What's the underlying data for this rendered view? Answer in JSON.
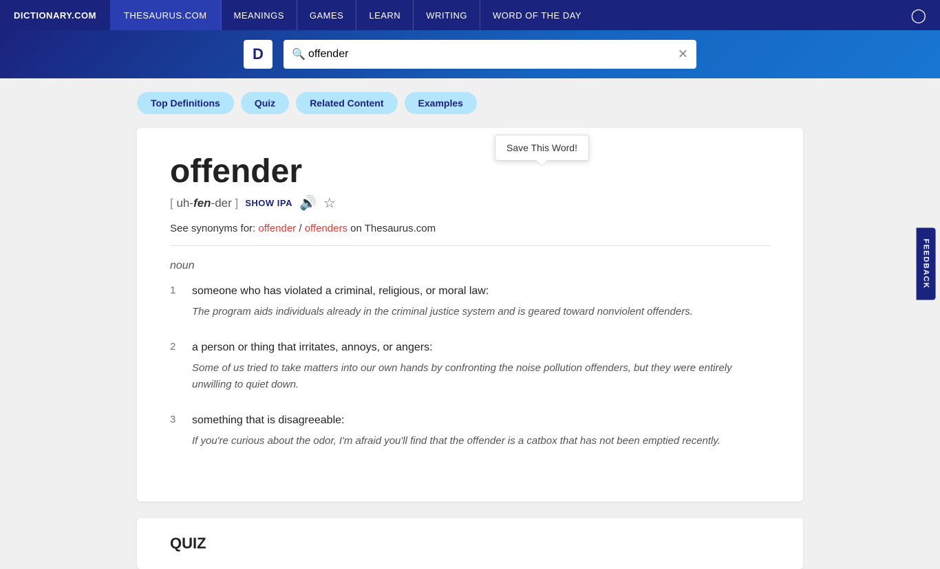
{
  "topnav": {
    "brand": "DICTIONARY.COM",
    "thesaurus": "THESAURUS.COM",
    "links": [
      "MEANINGS",
      "GAMES",
      "LEARN",
      "WRITING",
      "WORD OF THE DAY"
    ]
  },
  "search": {
    "value": "offender",
    "placeholder": "offender"
  },
  "logo": {
    "letter": "D"
  },
  "tabs": [
    {
      "label": "Top Definitions"
    },
    {
      "label": "Quiz"
    },
    {
      "label": "Related Content"
    },
    {
      "label": "Examples"
    }
  ],
  "tooltip": {
    "text": "Save This Word!"
  },
  "definition": {
    "word": "offender",
    "pronunciation_open": "[ ",
    "pronunciation_pre": "uh-",
    "pronunciation_stressed": "fen",
    "pronunciation_post": "-der",
    "pronunciation_close": " ]",
    "show_ipa": "SHOW IPA",
    "synonyms_text": "See synonyms for:",
    "synonym1": "offender",
    "separator": " / ",
    "synonym2": "offenders",
    "on_text": " on ",
    "thesaurus": "Thesaurus.com",
    "pos": "noun",
    "definitions": [
      {
        "number": "1",
        "text": "someone who has violated a criminal, religious, or moral law:",
        "example": "The program aids individuals already in the criminal justice system and is geared toward nonviolent offenders."
      },
      {
        "number": "2",
        "text": "a person or thing that irritates, annoys, or angers:",
        "example": "Some of us tried to take matters into our own hands by confronting the noise pollution offenders, but they were entirely unwilling to quiet down."
      },
      {
        "number": "3",
        "text": "something that is disagreeable:",
        "example": "If you're curious about the odor, I'm afraid you'll find that the offender is a catbox that has not been emptied recently."
      }
    ]
  },
  "quiz_section": {
    "heading": "QUIZ"
  },
  "feedback": {
    "label": "FEEDBACK"
  }
}
